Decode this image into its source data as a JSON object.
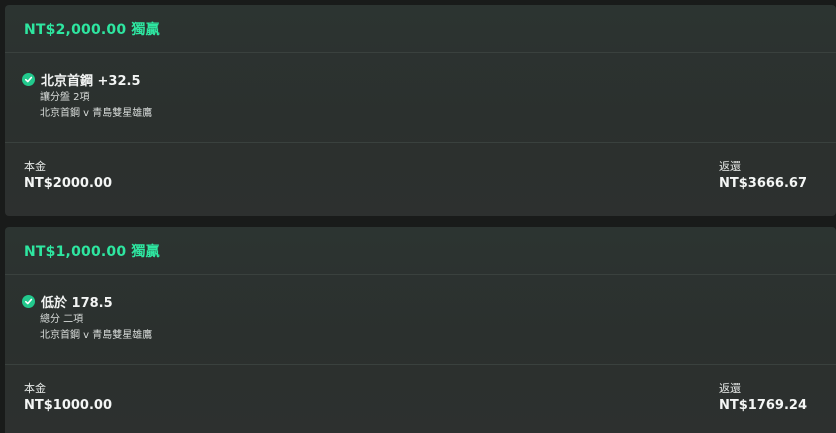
{
  "bets": [
    {
      "header": "NT$2,000.00 獨贏",
      "selection": "北京首鋼 +32.5",
      "market": "讓分盤 2項",
      "match": "北京首鋼 v 青島雙星雄鷹",
      "stake_label": "本金",
      "stake_value": "NT$2000.00",
      "return_label": "返還",
      "return_value": "NT$3666.67",
      "status_icon": "check-circle-icon"
    },
    {
      "header": "NT$1,000.00 獨贏",
      "selection": "低於 178.5",
      "market": "總分 二項",
      "match": "北京首鋼 v 青島雙星雄鷹",
      "stake_label": "本金",
      "stake_value": "NT$1000.00",
      "return_label": "返還",
      "return_value": "NT$1769.24",
      "status_icon": "check-circle-icon"
    }
  ],
  "colors": {
    "accent": "#2ee6a0",
    "check": "#22c98d",
    "card_bg": "#2c3431",
    "page_bg": "#191b1a"
  }
}
